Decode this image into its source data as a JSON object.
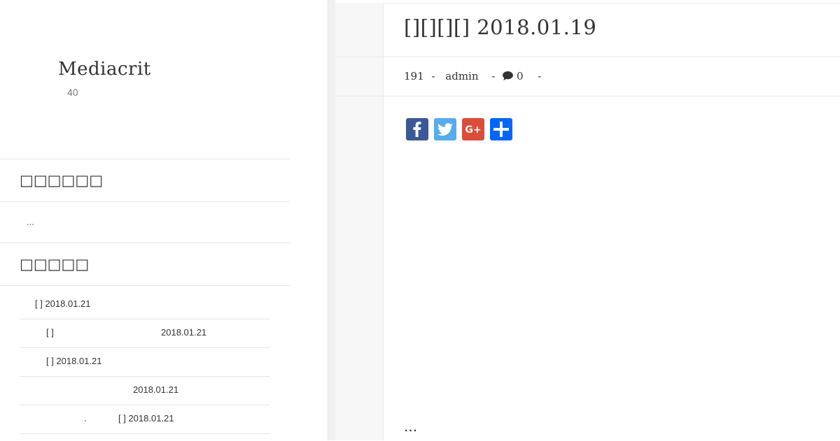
{
  "site": {
    "title": "Mediacrit",
    "description": "40"
  },
  "widgets": {
    "w1": {
      "title": "□□□□□□",
      "ellipsis": "..."
    },
    "w2": {
      "title": "□□□□□"
    },
    "recent": [
      {
        "text": "[ ] 2018.01.21"
      },
      {
        "text": "[ ]",
        "date": "2018.01.21"
      },
      {
        "text": "[ ] 2018.01.21"
      },
      {
        "text": "2018.01.21"
      },
      {
        "text": ".",
        "date": "[ ] 2018.01.21"
      }
    ]
  },
  "post": {
    "title": "[][][][] 2018.01.19",
    "meta": {
      "views": "191",
      "sep": "-",
      "author": "admin",
      "comments": "0"
    },
    "more": "..."
  },
  "share": [
    {
      "name": "facebook",
      "color": "#3b5998"
    },
    {
      "name": "twitter",
      "color": "#55acee"
    },
    {
      "name": "google-plus",
      "color": "#dd4b39"
    },
    {
      "name": "share",
      "color": "#0166ff"
    }
  ]
}
